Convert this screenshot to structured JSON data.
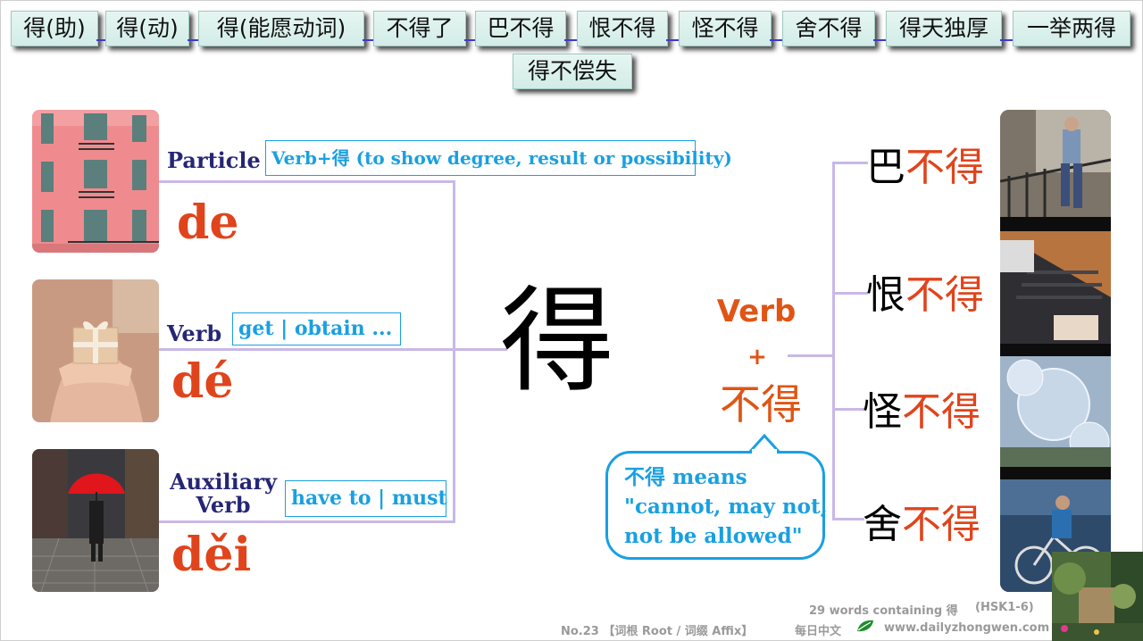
{
  "tabs": [
    "得(助)",
    "得(动)",
    "得(能愿动词)",
    "不得了",
    "巴不得",
    "恨不得",
    "怪不得",
    "舍不得",
    "得天独厚",
    "一举两得",
    "得不偿失"
  ],
  "center_char": "得",
  "senses": [
    {
      "role": "Particle",
      "gloss": "Verb+得 (to show degree, result or possibility)",
      "pinyin": "de",
      "photo_icon": "building-photo"
    },
    {
      "role": "Verb",
      "gloss": "get | obtain ...",
      "pinyin": "dé",
      "photo_icon": "gift-photo"
    },
    {
      "role_line1": "Auxiliary",
      "role_line2": "Verb",
      "gloss": "have to | must",
      "pinyin": "děi",
      "photo_icon": "umbrella-photo"
    }
  ],
  "formula": {
    "verb": "Verb",
    "plus": "+",
    "budei": "不得"
  },
  "bubble": {
    "line1": "不得 means",
    "line2": "\"cannot, may not,",
    "line3": "not be allowed\""
  },
  "words": [
    {
      "prefix": "巴",
      "suffix": "不得"
    },
    {
      "prefix": "恨",
      "suffix": "不得"
    },
    {
      "prefix": "怪",
      "suffix": "不得"
    },
    {
      "prefix": "舍",
      "suffix": "不得"
    }
  ],
  "footer": {
    "count": "29 words containing 得",
    "level": "(HSK1-6)",
    "series": "No.23 【词根 Root / 词缀 Affix】",
    "brand": "每日中文",
    "url": "www.dailyzhongwen.com"
  },
  "colors": {
    "accent_orange": "#e0441c",
    "gloss_blue": "#1aa0e0",
    "role_navy": "#262676",
    "tab_bg": "#d2ece7",
    "connector": "#c9b8e6"
  }
}
